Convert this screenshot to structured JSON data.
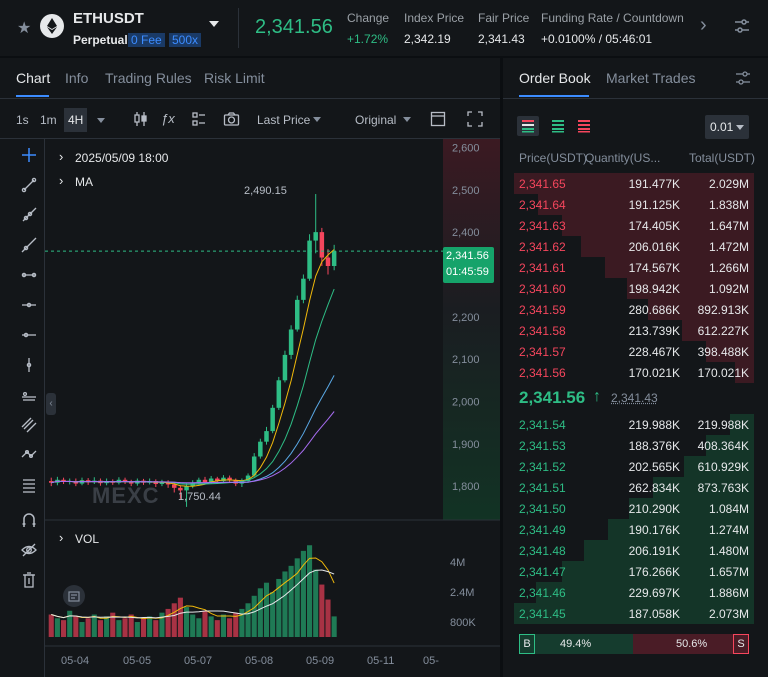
{
  "header": {
    "symbol": "ETHUSDT",
    "contract_type": "Perpetual",
    "fee_badge": "0 Fee",
    "leverage_badge": "500x",
    "last_price": "2,341.56",
    "change_label": "Change",
    "change_value": "+1.72%",
    "index_label": "Index Price",
    "index_value": "2,342.19",
    "fair_label": "Fair Price",
    "fair_value": "2,341.43",
    "funding_label": "Funding Rate / Countdown",
    "funding_value": "+0.0100% / 05:46:01",
    "colors": {
      "up": "#2ebd85",
      "down": "#f6465d",
      "accent": "#3c8cff"
    }
  },
  "chart_tabs": [
    "Chart",
    "Info",
    "Trading Rules",
    "Risk Limit"
  ],
  "toolbar": {
    "intervals": [
      "1s",
      "1m",
      "4H"
    ],
    "price_type": "Last Price",
    "view_mode": "Original"
  },
  "chart_overlay": {
    "datetime": "2025/05/09 18:00",
    "ma_label": "MA",
    "vol_label": "VOL",
    "high_annotation": "2,490.15",
    "low_annotation": "1,750.44",
    "current_price_tag": "2,341.56",
    "countdown_tag": "01:45:59",
    "watermark": "MEXC"
  },
  "chart_data": {
    "type": "candlestick",
    "price_axis_ticks": [
      "2,600",
      "2,500",
      "2,400",
      "2,300",
      "2,200",
      "2,100",
      "2,000",
      "1,900",
      "1,800"
    ],
    "volume_axis_ticks": [
      "4M",
      "2.4M",
      "800K"
    ],
    "date_ticks": [
      "05-04",
      "05-05",
      "05-07",
      "05-08",
      "05-09",
      "05-11",
      "05-"
    ],
    "ylim": [
      1720,
      2620
    ],
    "candles": [
      [
        1812,
        1808,
        1820,
        1800
      ],
      [
        1808,
        1815,
        1822,
        1802
      ],
      [
        1815,
        1810,
        1820,
        1805
      ],
      [
        1810,
        1812,
        1818,
        1804
      ],
      [
        1812,
        1806,
        1818,
        1800
      ],
      [
        1806,
        1814,
        1820,
        1802
      ],
      [
        1814,
        1809,
        1819,
        1803
      ],
      [
        1809,
        1813,
        1821,
        1805
      ],
      [
        1813,
        1807,
        1818,
        1801
      ],
      [
        1807,
        1812,
        1818,
        1802
      ],
      [
        1812,
        1808,
        1816,
        1803
      ],
      [
        1808,
        1815,
        1821,
        1804
      ],
      [
        1815,
        1810,
        1820,
        1805
      ],
      [
        1810,
        1806,
        1815,
        1800
      ],
      [
        1806,
        1813,
        1818,
        1801
      ],
      [
        1813,
        1808,
        1817,
        1803
      ],
      [
        1808,
        1812,
        1818,
        1804
      ],
      [
        1812,
        1805,
        1816,
        1798
      ],
      [
        1805,
        1810,
        1815,
        1800
      ],
      [
        1810,
        1804,
        1814,
        1796
      ],
      [
        1804,
        1796,
        1810,
        1785
      ],
      [
        1796,
        1790,
        1802,
        1770
      ],
      [
        1790,
        1800,
        1806,
        1751
      ],
      [
        1800,
        1808,
        1814,
        1795
      ],
      [
        1808,
        1815,
        1820,
        1803
      ],
      [
        1815,
        1809,
        1822,
        1804
      ],
      [
        1809,
        1818,
        1824,
        1805
      ],
      [
        1818,
        1812,
        1822,
        1806
      ],
      [
        1812,
        1820,
        1826,
        1808
      ],
      [
        1820,
        1814,
        1825,
        1808
      ],
      [
        1814,
        1806,
        1818,
        1800
      ],
      [
        1806,
        1812,
        1818,
        1798
      ],
      [
        1812,
        1825,
        1830,
        1808
      ],
      [
        1825,
        1870,
        1878,
        1822
      ],
      [
        1870,
        1905,
        1912,
        1865
      ],
      [
        1905,
        1930,
        1940,
        1898
      ],
      [
        1930,
        1985,
        1992,
        1925
      ],
      [
        1985,
        2050,
        2058,
        1980
      ],
      [
        2050,
        2110,
        2120,
        2045
      ],
      [
        2110,
        2170,
        2180,
        2100
      ],
      [
        2170,
        2240,
        2250,
        2165
      ],
      [
        2240,
        2290,
        2300,
        2232
      ],
      [
        2290,
        2380,
        2395,
        2285
      ],
      [
        2380,
        2400,
        2490,
        2350
      ],
      [
        2400,
        2340,
        2410,
        2320
      ],
      [
        2340,
        2320,
        2360,
        2300
      ],
      [
        2320,
        2355,
        2370,
        2310
      ]
    ],
    "volumes": [
      1.2,
      1.0,
      0.9,
      1.4,
      1.1,
      0.8,
      1.0,
      1.2,
      0.9,
      1.1,
      1.3,
      0.9,
      1.0,
      1.2,
      0.8,
      1.0,
      1.1,
      0.9,
      1.3,
      1.5,
      1.8,
      2.1,
      1.6,
      1.2,
      1.0,
      1.4,
      1.1,
      0.9,
      1.2,
      1.0,
      1.3,
      1.5,
      1.8,
      2.2,
      2.6,
      2.9,
      2.4,
      3.1,
      3.5,
      3.8,
      4.2,
      4.6,
      4.9,
      3.6,
      2.8,
      2.0,
      1.1
    ]
  },
  "orderbook": {
    "tabs": [
      "Order Book",
      "Market Trades"
    ],
    "precision": "0.01",
    "columns": [
      "Price(USDT)",
      "Quantity(US...",
      "Total(USDT)"
    ],
    "asks": [
      {
        "price": "2,341.65",
        "qty": "191.477K",
        "total": "2.029M",
        "depth": 1.0
      },
      {
        "price": "2,341.64",
        "qty": "191.125K",
        "total": "1.838M",
        "depth": 0.9
      },
      {
        "price": "2,341.63",
        "qty": "174.405K",
        "total": "1.647M",
        "depth": 0.8
      },
      {
        "price": "2,341.62",
        "qty": "206.016K",
        "total": "1.472M",
        "depth": 0.72
      },
      {
        "price": "2,341.61",
        "qty": "174.567K",
        "total": "1.266M",
        "depth": 0.62
      },
      {
        "price": "2,341.60",
        "qty": "198.942K",
        "total": "1.092M",
        "depth": 0.53
      },
      {
        "price": "2,341.59",
        "qty": "280.686K",
        "total": "892.913K",
        "depth": 0.44
      },
      {
        "price": "2,341.58",
        "qty": "213.739K",
        "total": "612.227K",
        "depth": 0.3
      },
      {
        "price": "2,341.57",
        "qty": "228.467K",
        "total": "398.488K",
        "depth": 0.2
      },
      {
        "price": "2,341.56",
        "qty": "170.021K",
        "total": "170.021K",
        "depth": 0.08
      }
    ],
    "mid_price": "2,341.56",
    "mid_mark": "2,341.43",
    "bids": [
      {
        "price": "2,341.54",
        "qty": "219.988K",
        "total": "219.988K",
        "depth": 0.1
      },
      {
        "price": "2,341.53",
        "qty": "188.376K",
        "total": "408.364K",
        "depth": 0.2
      },
      {
        "price": "2,341.52",
        "qty": "202.565K",
        "total": "610.929K",
        "depth": 0.29
      },
      {
        "price": "2,341.51",
        "qty": "262.834K",
        "total": "873.763K",
        "depth": 0.42
      },
      {
        "price": "2,341.50",
        "qty": "210.290K",
        "total": "1.084M",
        "depth": 0.52
      },
      {
        "price": "2,341.49",
        "qty": "190.176K",
        "total": "1.274M",
        "depth": 0.61
      },
      {
        "price": "2,341.48",
        "qty": "206.191K",
        "total": "1.480M",
        "depth": 0.71
      },
      {
        "price": "2,341.47",
        "qty": "176.266K",
        "total": "1.657M",
        "depth": 0.8
      },
      {
        "price": "2,341.46",
        "qty": "229.697K",
        "total": "1.886M",
        "depth": 0.91
      },
      {
        "price": "2,341.45",
        "qty": "187.058K",
        "total": "2.073M",
        "depth": 1.0
      }
    ],
    "buy_label": "B",
    "sell_label": "S",
    "buy_ratio": "49.4%",
    "sell_ratio": "50.6%"
  }
}
